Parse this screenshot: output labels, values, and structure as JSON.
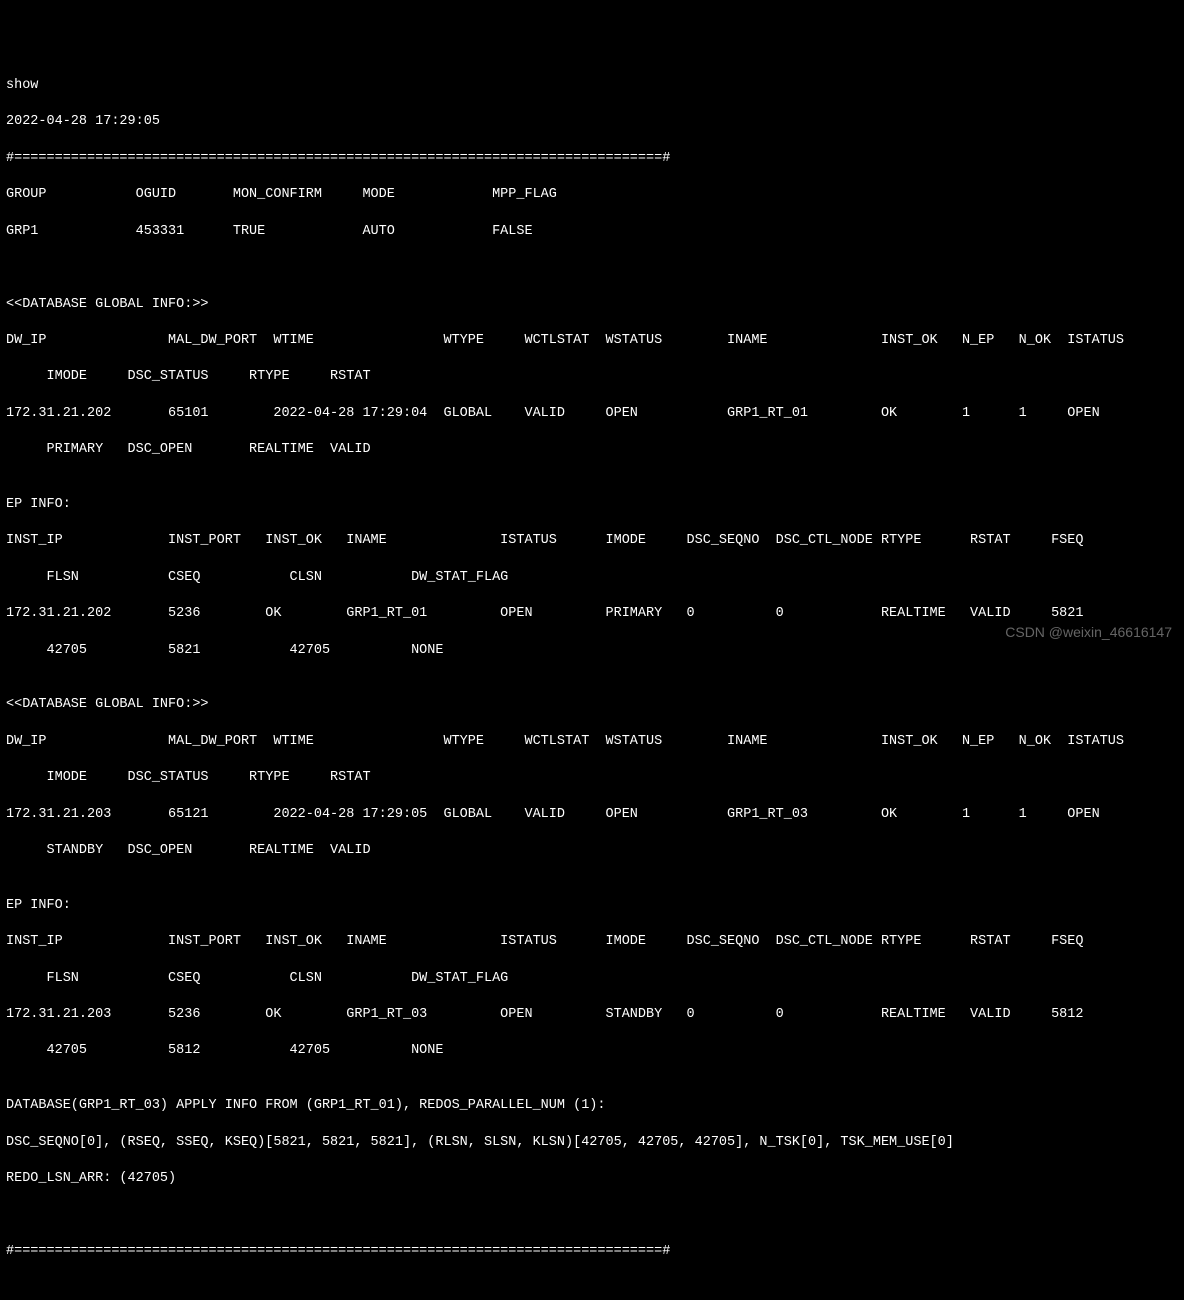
{
  "cmd": "show",
  "timestamp": "2022-04-28 17:29:05",
  "divider": "#================================================================================#",
  "group_header": "GROUP           OGUID       MON_CONFIRM     MODE            MPP_FLAG",
  "group_row": "GRP1            453331      TRUE            AUTO            FALSE",
  "blank": "",
  "db_global_title": "<<DATABASE GLOBAL INFO:>>",
  "db_hdr1": "DW_IP               MAL_DW_PORT  WTIME                WTYPE     WCTLSTAT  WSTATUS        INAME              INST_OK   N_EP   N_OK  ISTATUS",
  "db_hdr2": "     IMODE     DSC_STATUS     RTYPE     RSTAT",
  "db1_row1": "172.31.21.202       65101        2022-04-28 17:29:04  GLOBAL    VALID     OPEN           GRP1_RT_01         OK        1      1     OPEN",
  "db1_row2": "     PRIMARY   DSC_OPEN       REALTIME  VALID",
  "ep_title": "EP INFO:",
  "ep_hdr1": "INST_IP             INST_PORT   INST_OK   INAME              ISTATUS      IMODE     DSC_SEQNO  DSC_CTL_NODE RTYPE      RSTAT     FSEQ",
  "ep_hdr2": "     FLSN           CSEQ           CLSN           DW_STAT_FLAG",
  "ep1_row1": "172.31.21.202       5236        OK        GRP1_RT_01         OPEN         PRIMARY   0          0            REALTIME   VALID     5821",
  "ep1_row2": "     42705          5821           42705          NONE",
  "db2_row1": "172.31.21.203       65121        2022-04-28 17:29:05  GLOBAL    VALID     OPEN           GRP1_RT_03         OK        1      1     OPEN",
  "db2_row2": "     STANDBY   DSC_OPEN       REALTIME  VALID",
  "ep2_row1": "172.31.21.203       5236        OK        GRP1_RT_03         OPEN         STANDBY   0          0            REALTIME   VALID     5812",
  "ep2_row2": "     42705          5812           42705          NONE",
  "apply_info1": "DATABASE(GRP1_RT_03) APPLY INFO FROM (GRP1_RT_01), REDOS_PARALLEL_NUM (1):",
  "apply_info2": "DSC_SEQNO[0], (RSEQ, SSEQ, KSEQ)[5821, 5821, 5821], (RLSN, SLSN, KLSN)[42705, 42705, 42705], N_TSK[0], TSK_MEM_USE[0]",
  "apply_info3": "REDO_LSN_ARR: (42705)",
  "watermark": "CSDN @weixin_46616147"
}
